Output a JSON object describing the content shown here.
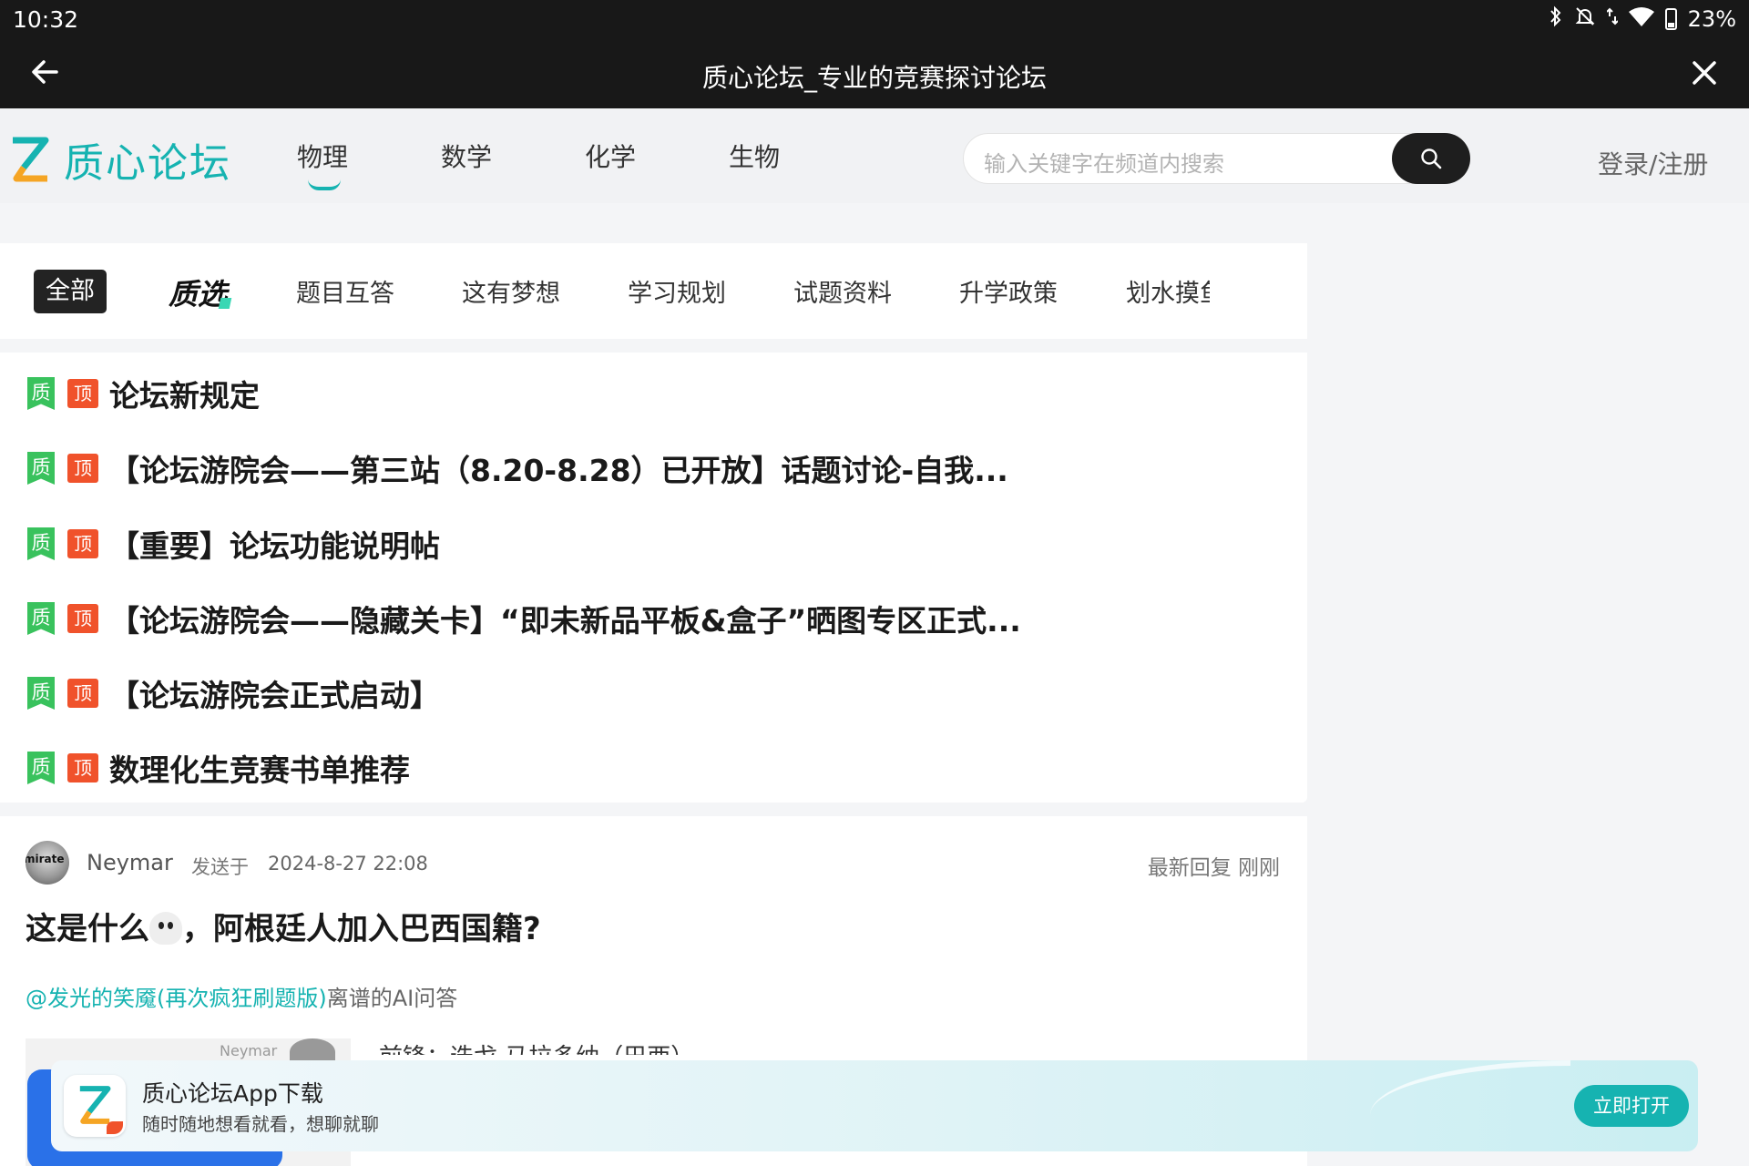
{
  "status_bar": {
    "time": "10:32",
    "battery": "23%",
    "icons": [
      "bluetooth-icon",
      "mute-icon",
      "data-arrows-icon",
      "wifi-icon",
      "battery-icon"
    ]
  },
  "title_bar": {
    "title": "质心论坛_专业的竞赛探讨论坛"
  },
  "header": {
    "logo_text": "质心论坛",
    "subjects": [
      {
        "label": "物理",
        "active": true
      },
      {
        "label": "数学",
        "active": false
      },
      {
        "label": "化学",
        "active": false
      },
      {
        "label": "生物",
        "active": false
      }
    ],
    "search_placeholder": "输入关键字在频道内搜索",
    "login_label": "登录/注册"
  },
  "categories": {
    "all_label": "全部",
    "pick_label": "质选",
    "items": [
      "题目互答",
      "这有梦想",
      "学习规划",
      "试题资料",
      "升学政策"
    ],
    "truncated_item": "划水摸鱼"
  },
  "pinned": {
    "quality_badge": "质",
    "top_badge": "顶",
    "posts": [
      "论坛新规定",
      "【论坛游院会——第三站（8.20-8.28）已开放】话题讨论-自我...",
      "【重要】论坛功能说明帖",
      "【论坛游院会——隐藏关卡】“即未新品平板&盒子”晒图专区正式...",
      "【论坛游院会正式启动】",
      "数理化生竞赛书单推荐"
    ]
  },
  "post": {
    "avatar_text": "mirate",
    "author": "Neymar",
    "sent_label": "发送于",
    "date": "2024-8-27 22:08",
    "latest_reply": "最新回复 刚刚",
    "title_before": "这是什么",
    "title_after": "，阿根廷人加入巴西国籍?",
    "mention": "@发光的笑魇(再次疯狂刷题版)",
    "mention_rest": "离谱的AI问答",
    "preview_name": "Neymar",
    "preview_text": "前锋：迭戈·马拉多纳（巴西）"
  },
  "app_banner": {
    "title": "质心论坛App下载",
    "subtitle": "随时随地想看就看，想聊就聊",
    "button": "立即打开"
  },
  "colors": {
    "accent": "#16b3b1",
    "top_badge": "#f0522b",
    "quality_badge": "#39c25d",
    "dark_bar": "#181818"
  }
}
